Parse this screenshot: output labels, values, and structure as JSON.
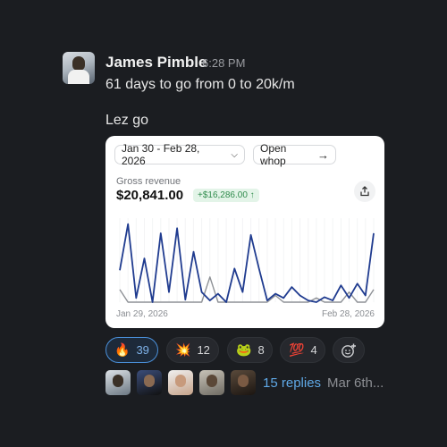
{
  "message": {
    "author": "James Pimble",
    "time": "6:28 PM",
    "line1": "61 days to go from 0 to 20k/m",
    "line2": "Lez go"
  },
  "card": {
    "date_range": "Jan 30 - Feb 28, 2026",
    "open_label": "Open whop",
    "metric_label": "Gross revenue",
    "metric_value": "$20,841.00",
    "delta": "+$16,286.00 ↑",
    "x_start": "Jan 29, 2026",
    "x_end": "Feb 28, 2026"
  },
  "chart_data": {
    "type": "line",
    "title": "Gross revenue",
    "xlabel": "",
    "ylabel": "",
    "x_range": [
      "Jan 29, 2026",
      "Feb 28, 2026"
    ],
    "grid": false,
    "series": [
      {
        "color": "#1f3b8f",
        "values": [
          0.38,
          0.93,
          0.05,
          0.52,
          0.0,
          0.82,
          0.12,
          0.88,
          0.03,
          0.6,
          0.12,
          0.02,
          0.1,
          0.0,
          0.4,
          0.12,
          0.8,
          0.4,
          0.02,
          0.1,
          0.05,
          0.18,
          0.08,
          0.02,
          0.0,
          0.06,
          0.02,
          0.2,
          0.05,
          0.22,
          0.08,
          0.82
        ]
      },
      {
        "color": "#8e9196",
        "values": [
          0.15,
          0.0,
          0.0,
          0.0,
          0.0,
          0.0,
          0.0,
          0.0,
          0.0,
          0.0,
          0.0,
          0.3,
          0.0,
          0.0,
          0.0,
          0.0,
          0.0,
          0.0,
          0.0,
          0.08,
          0.0,
          0.0,
          0.0,
          0.0,
          0.05,
          0.0,
          0.0,
          0.0,
          0.12,
          0.0,
          0.0,
          0.15
        ]
      }
    ]
  },
  "reactions": [
    {
      "emoji": "🔥",
      "count": "39",
      "active": true
    },
    {
      "emoji": "💥",
      "count": "12",
      "active": false
    },
    {
      "emoji": "🐸",
      "count": "8",
      "active": false
    },
    {
      "emoji": "💯",
      "count": "4",
      "active": false
    }
  ],
  "add_reaction_icon": "add-reaction-icon",
  "thread": {
    "replies": "15 replies",
    "last_date": "Mar 6th..."
  },
  "colors": {
    "background": "#1b1d21",
    "accent": "#5fa8e6",
    "series_primary": "#1f3b8f",
    "series_secondary": "#8e9196",
    "delta_green": "#2f8b4c"
  }
}
